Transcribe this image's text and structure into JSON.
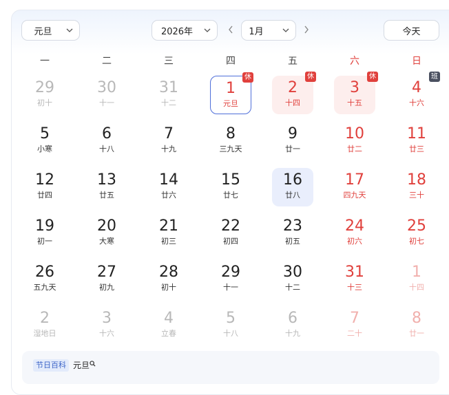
{
  "controls": {
    "holiday_select": "元旦",
    "year_select": "2026年",
    "month_select": "1月",
    "today_button": "今天"
  },
  "colors": {
    "weekend_red": "#e0403c",
    "selected_border": "#4e6ed9",
    "today_bg": "#e9eefc",
    "holiday_bg": "#fdeeed",
    "work_badge": "#4a5060"
  },
  "weekdays": [
    "一",
    "二",
    "三",
    "四",
    "五",
    "六",
    "日"
  ],
  "weeks": [
    [
      {
        "day": "29",
        "lunar": "初十",
        "other": true
      },
      {
        "day": "30",
        "lunar": "十一",
        "other": true
      },
      {
        "day": "31",
        "lunar": "十二",
        "other": true
      },
      {
        "day": "1",
        "lunar": "元旦",
        "badge": "休",
        "selected": true
      },
      {
        "day": "2",
        "lunar": "十四",
        "badge": "休",
        "holiday": true
      },
      {
        "day": "3",
        "lunar": "十五",
        "badge": "休",
        "holiday": true
      },
      {
        "day": "4",
        "lunar": "十六",
        "badge": "班",
        "workday": true
      }
    ],
    [
      {
        "day": "5",
        "lunar": "小寒"
      },
      {
        "day": "6",
        "lunar": "十八"
      },
      {
        "day": "7",
        "lunar": "十九"
      },
      {
        "day": "8",
        "lunar": "三九天"
      },
      {
        "day": "9",
        "lunar": "廿一"
      },
      {
        "day": "10",
        "lunar": "廿二"
      },
      {
        "day": "11",
        "lunar": "廿三"
      }
    ],
    [
      {
        "day": "12",
        "lunar": "廿四"
      },
      {
        "day": "13",
        "lunar": "廿五"
      },
      {
        "day": "14",
        "lunar": "廿六"
      },
      {
        "day": "15",
        "lunar": "廿七"
      },
      {
        "day": "16",
        "lunar": "廿八",
        "today": true
      },
      {
        "day": "17",
        "lunar": "四九天"
      },
      {
        "day": "18",
        "lunar": "三十"
      }
    ],
    [
      {
        "day": "19",
        "lunar": "初一"
      },
      {
        "day": "20",
        "lunar": "大寒"
      },
      {
        "day": "21",
        "lunar": "初三"
      },
      {
        "day": "22",
        "lunar": "初四"
      },
      {
        "day": "23",
        "lunar": "初五"
      },
      {
        "day": "24",
        "lunar": "初六"
      },
      {
        "day": "25",
        "lunar": "初七"
      }
    ],
    [
      {
        "day": "26",
        "lunar": "五九天"
      },
      {
        "day": "27",
        "lunar": "初九"
      },
      {
        "day": "28",
        "lunar": "初十"
      },
      {
        "day": "29",
        "lunar": "十一"
      },
      {
        "day": "30",
        "lunar": "十二"
      },
      {
        "day": "31",
        "lunar": "十三"
      },
      {
        "day": "1",
        "lunar": "十四",
        "other": true
      }
    ],
    [
      {
        "day": "2",
        "lunar": "湿地日",
        "other": true
      },
      {
        "day": "3",
        "lunar": "十六",
        "other": true
      },
      {
        "day": "4",
        "lunar": "立春",
        "other": true
      },
      {
        "day": "5",
        "lunar": "十八",
        "other": true
      },
      {
        "day": "6",
        "lunar": "十九",
        "other": true
      },
      {
        "day": "7",
        "lunar": "二十",
        "other": true
      },
      {
        "day": "8",
        "lunar": "廿一",
        "other": true
      }
    ]
  ],
  "footer": {
    "tag": "节日百科",
    "holiday_name": "元旦"
  },
  "icons": {
    "select_chevron": "chevron-down-icon",
    "prev": "chevron-left-icon",
    "next": "chevron-right-icon",
    "search": "search-icon"
  }
}
